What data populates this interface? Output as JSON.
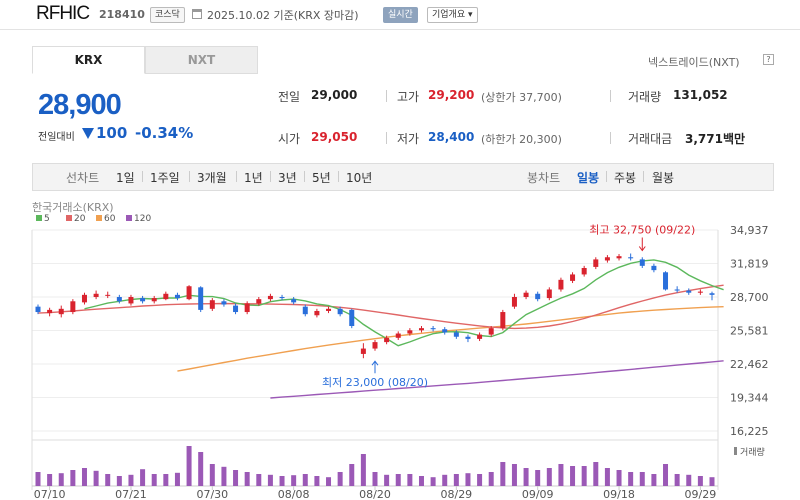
{
  "header": {
    "stock_name": "RFHIC",
    "stock_code": "218410",
    "market_badge": "코스닥",
    "date_basis": "2025.10.02  기준(KRX 장마감)",
    "realtime_badge": "실시간",
    "company_button": "기업개요 ▾"
  },
  "tabs": {
    "krx": "KRX",
    "nxt": "NXT",
    "nxt_link": "넥스트레이드(NXT)",
    "help": "?"
  },
  "quote": {
    "price": "28,900",
    "change_label": "전일대비",
    "change_value": "100",
    "change_percent": "-0.34%"
  },
  "info": {
    "prev_close_label": "전일",
    "prev_close": "29,000",
    "high_label": "고가",
    "high": "29,200",
    "upper_limit": "(상한가 37,700)",
    "volume_label": "거래량",
    "volume": "131,052",
    "open_label": "시가",
    "open": "29,050",
    "low_label": "저가",
    "low": "28,400",
    "lower_limit": "(하한가 20,300)",
    "turnover_label": "거래대금",
    "turnover": "3,771백만"
  },
  "period_bar": {
    "line_label": "선차트",
    "line_items": [
      "1일",
      "1주일",
      "3개월",
      "1년",
      "3년",
      "5년",
      "10년"
    ],
    "candle_label": "봉차트",
    "candle_items": [
      "일봉",
      "주봉",
      "월봉"
    ],
    "active_candle": "일봉"
  },
  "colors": {
    "up": "#d9232e",
    "down": "#2a6fdb",
    "ma5": "#5cb85c",
    "ma20": "#e06666",
    "ma60": "#f0a050",
    "ma120": "#9b59b6",
    "volume": "#9b59b6"
  },
  "chart_data": {
    "type": "candlestick",
    "title": "한국거래소(KRX)",
    "legend": [
      {
        "name": "5",
        "color": "#5cb85c"
      },
      {
        "name": "20",
        "color": "#e06666"
      },
      {
        "name": "60",
        "color": "#f0a050"
      },
      {
        "name": "120",
        "color": "#9b59b6"
      }
    ],
    "y_ticks": [
      34937,
      31819,
      28700,
      25581,
      22462,
      19344,
      16225
    ],
    "y_tick_labels": [
      "34,937",
      "31,819",
      "28,700",
      "25,581",
      "22,462",
      "19,344",
      "16,225"
    ],
    "ylim": [
      16225,
      34937
    ],
    "x_ticks": [
      {
        "label": "07/10",
        "index": 1
      },
      {
        "label": "07/21",
        "index": 8
      },
      {
        "label": "07/30",
        "index": 15
      },
      {
        "label": "08/08",
        "index": 22
      },
      {
        "label": "08/20",
        "index": 29
      },
      {
        "label": "08/29",
        "index": 36
      },
      {
        "label": "09/09",
        "index": 43
      },
      {
        "label": "09/18",
        "index": 50
      },
      {
        "label": "09/29",
        "index": 57
      }
    ],
    "high_annotation": {
      "text": "최고 32,750 (09/22)",
      "index": 52,
      "value": 32750
    },
    "low_annotation": {
      "text": "최저 23,000 (08/20)",
      "index": 29,
      "value": 23000
    },
    "volume_label": "거래량",
    "candles": [
      {
        "o": 27800,
        "c": 27300,
        "h": 28000,
        "l": 27100,
        "v": 0.35
      },
      {
        "o": 27200,
        "c": 27500,
        "h": 27700,
        "l": 26900,
        "v": 0.3
      },
      {
        "o": 27100,
        "c": 27600,
        "h": 27900,
        "l": 26800,
        "v": 0.32
      },
      {
        "o": 27300,
        "c": 28300,
        "h": 28500,
        "l": 27100,
        "v": 0.4
      },
      {
        "o": 28200,
        "c": 28900,
        "h": 29100,
        "l": 28000,
        "v": 0.45
      },
      {
        "o": 28700,
        "c": 29000,
        "h": 29300,
        "l": 28500,
        "v": 0.38
      },
      {
        "o": 28900,
        "c": 28900,
        "h": 29200,
        "l": 28600,
        "v": 0.3
      },
      {
        "o": 28700,
        "c": 28300,
        "h": 28900,
        "l": 28100,
        "v": 0.25
      },
      {
        "o": 28100,
        "c": 28700,
        "h": 28900,
        "l": 27900,
        "v": 0.28
      },
      {
        "o": 28600,
        "c": 28300,
        "h": 28800,
        "l": 28100,
        "v": 0.42
      },
      {
        "o": 28300,
        "c": 28600,
        "h": 28800,
        "l": 28100,
        "v": 0.3
      },
      {
        "o": 28500,
        "c": 29000,
        "h": 29200,
        "l": 28400,
        "v": 0.3
      },
      {
        "o": 28900,
        "c": 28600,
        "h": 29100,
        "l": 28400,
        "v": 0.33
      },
      {
        "o": 28500,
        "c": 29700,
        "h": 29800,
        "l": 28400,
        "v": 1.0
      },
      {
        "o": 29600,
        "c": 27500,
        "h": 29700,
        "l": 27300,
        "v": 0.85
      },
      {
        "o": 27600,
        "c": 28400,
        "h": 28600,
        "l": 27400,
        "v": 0.55
      },
      {
        "o": 28300,
        "c": 28000,
        "h": 28500,
        "l": 27800,
        "v": 0.48
      },
      {
        "o": 27900,
        "c": 27300,
        "h": 28100,
        "l": 27100,
        "v": 0.4
      },
      {
        "o": 27300,
        "c": 28100,
        "h": 28300,
        "l": 27100,
        "v": 0.35
      },
      {
        "o": 28100,
        "c": 28500,
        "h": 28700,
        "l": 27900,
        "v": 0.3
      },
      {
        "o": 28500,
        "c": 28800,
        "h": 29000,
        "l": 28300,
        "v": 0.28
      },
      {
        "o": 28700,
        "c": 28600,
        "h": 28900,
        "l": 28400,
        "v": 0.25
      },
      {
        "o": 28500,
        "c": 28200,
        "h": 28700,
        "l": 28000,
        "v": 0.27
      },
      {
        "o": 27800,
        "c": 27100,
        "h": 28000,
        "l": 26900,
        "v": 0.3
      },
      {
        "o": 27000,
        "c": 27400,
        "h": 27600,
        "l": 26800,
        "v": 0.25
      },
      {
        "o": 27400,
        "c": 27600,
        "h": 27800,
        "l": 27200,
        "v": 0.22
      },
      {
        "o": 27600,
        "c": 27100,
        "h": 27800,
        "l": 26900,
        "v": 0.35
      },
      {
        "o": 27500,
        "c": 26000,
        "h": 27600,
        "l": 25800,
        "v": 0.55
      },
      {
        "o": 23400,
        "c": 23900,
        "h": 24400,
        "l": 23000,
        "v": 0.8
      },
      {
        "o": 23900,
        "c": 24500,
        "h": 24700,
        "l": 23700,
        "v": 0.35
      },
      {
        "o": 24500,
        "c": 24900,
        "h": 25100,
        "l": 24300,
        "v": 0.28
      },
      {
        "o": 24900,
        "c": 25300,
        "h": 25500,
        "l": 24700,
        "v": 0.3
      },
      {
        "o": 25300,
        "c": 25600,
        "h": 25800,
        "l": 25100,
        "v": 0.3
      },
      {
        "o": 25600,
        "c": 25800,
        "h": 26000,
        "l": 25400,
        "v": 0.25
      },
      {
        "o": 25800,
        "c": 25700,
        "h": 26000,
        "l": 25500,
        "v": 0.22
      },
      {
        "o": 25700,
        "c": 25400,
        "h": 25900,
        "l": 25200,
        "v": 0.28
      },
      {
        "o": 25400,
        "c": 25000,
        "h": 25600,
        "l": 24800,
        "v": 0.3
      },
      {
        "o": 25000,
        "c": 24800,
        "h": 25200,
        "l": 24500,
        "v": 0.32
      },
      {
        "o": 24800,
        "c": 25200,
        "h": 25400,
        "l": 24600,
        "v": 0.3
      },
      {
        "o": 25200,
        "c": 25800,
        "h": 26000,
        "l": 25000,
        "v": 0.35
      },
      {
        "o": 25800,
        "c": 27300,
        "h": 27500,
        "l": 25600,
        "v": 0.6
      },
      {
        "o": 27800,
        "c": 28700,
        "h": 29000,
        "l": 27600,
        "v": 0.55
      },
      {
        "o": 28700,
        "c": 29100,
        "h": 29300,
        "l": 28500,
        "v": 0.45
      },
      {
        "o": 29000,
        "c": 28500,
        "h": 29200,
        "l": 28300,
        "v": 0.4
      },
      {
        "o": 28600,
        "c": 29400,
        "h": 29600,
        "l": 28400,
        "v": 0.45
      },
      {
        "o": 29400,
        "c": 30300,
        "h": 30500,
        "l": 29200,
        "v": 0.55
      },
      {
        "o": 30200,
        "c": 30800,
        "h": 31000,
        "l": 30000,
        "v": 0.5
      },
      {
        "o": 30800,
        "c": 31400,
        "h": 31600,
        "l": 30600,
        "v": 0.5
      },
      {
        "o": 31500,
        "c": 32200,
        "h": 32400,
        "l": 31300,
        "v": 0.6
      },
      {
        "o": 32100,
        "c": 32400,
        "h": 32600,
        "l": 31900,
        "v": 0.45
      },
      {
        "o": 32300,
        "c": 32500,
        "h": 32700,
        "l": 32100,
        "v": 0.4
      },
      {
        "o": 32400,
        "c": 32300,
        "h": 32750,
        "l": 32100,
        "v": 0.35
      },
      {
        "o": 32200,
        "c": 31600,
        "h": 32400,
        "l": 31400,
        "v": 0.35
      },
      {
        "o": 31600,
        "c": 31200,
        "h": 31800,
        "l": 31000,
        "v": 0.3
      },
      {
        "o": 31000,
        "c": 29400,
        "h": 31100,
        "l": 29300,
        "v": 0.55
      },
      {
        "o": 29400,
        "c": 29300,
        "h": 29700,
        "l": 29100,
        "v": 0.3
      },
      {
        "o": 29300,
        "c": 29100,
        "h": 29500,
        "l": 28900,
        "v": 0.28
      },
      {
        "o": 29100,
        "c": 29200,
        "h": 29400,
        "l": 28900,
        "v": 0.25
      },
      {
        "o": 29050,
        "c": 28900,
        "h": 29200,
        "l": 28400,
        "v": 0.22
      }
    ],
    "ma5": [
      null,
      null,
      null,
      null,
      27600,
      27860,
      28130,
      28300,
      28470,
      28560,
      28510,
      28620,
      28610,
      28860,
      28760,
      28740,
      28560,
      28140,
      27950,
      27920,
      28260,
      28420,
      28500,
      28340,
      28060,
      27900,
      27540,
      27000,
      26150,
      25450,
      24830,
      24170,
      24520,
      24930,
      25280,
      25450,
      25470,
      25380,
      25120,
      25010,
      25390,
      26240,
      27060,
      27580,
      28100,
      28600,
      29000,
      29500,
      30300,
      30970,
      31460,
      31840,
      32060,
      32150,
      31930,
      31460,
      30740,
      30210,
      29760,
      29380
    ],
    "ma20": [
      27200,
      27250,
      27320,
      27400,
      27480,
      27560,
      27640,
      27700,
      27780,
      27860,
      27920,
      27980,
      28020,
      28050,
      28070,
      28080,
      28090,
      28080,
      28070,
      28060,
      28040,
      28020,
      28000,
      27960,
      27900,
      27830,
      27740,
      27620,
      27480,
      27330,
      27180,
      27020,
      26860,
      26700,
      26550,
      26400,
      26260,
      26130,
      26010,
      25900,
      25820,
      25780,
      25800,
      25880,
      26000,
      26180,
      26420,
      26700,
      27020,
      27360,
      27700,
      28030,
      28330,
      28620,
      28880,
      29100,
      29300,
      29480,
      29650,
      29800
    ],
    "ma60": [
      null,
      null,
      null,
      null,
      null,
      null,
      null,
      null,
      null,
      null,
      null,
      null,
      21800,
      22000,
      22200,
      22400,
      22600,
      22800,
      23000,
      23180,
      23360,
      23540,
      23720,
      23900,
      24060,
      24220,
      24380,
      24530,
      24680,
      24820,
      24960,
      25090,
      25210,
      25320,
      25430,
      25530,
      25620,
      25710,
      25800,
      25890,
      25980,
      26080,
      26190,
      26310,
      26440,
      26570,
      26700,
      26830,
      26960,
      27080,
      27200,
      27300,
      27390,
      27470,
      27540,
      27600,
      27660,
      27710,
      27760,
      27800
    ],
    "ma120": [
      null,
      null,
      null,
      null,
      null,
      null,
      null,
      null,
      null,
      null,
      null,
      null,
      null,
      null,
      null,
      null,
      null,
      null,
      null,
      null,
      19300,
      19380,
      19460,
      19540,
      19620,
      19700,
      19780,
      19860,
      19940,
      20020,
      20100,
      20180,
      20260,
      20340,
      20420,
      20500,
      20580,
      20660,
      20750,
      20840,
      20930,
      21020,
      21110,
      21200,
      21290,
      21380,
      21470,
      21560,
      21660,
      21760,
      21860,
      21960,
      22060,
      22160,
      22260,
      22360,
      22460,
      22560,
      22660,
      22760
    ]
  }
}
